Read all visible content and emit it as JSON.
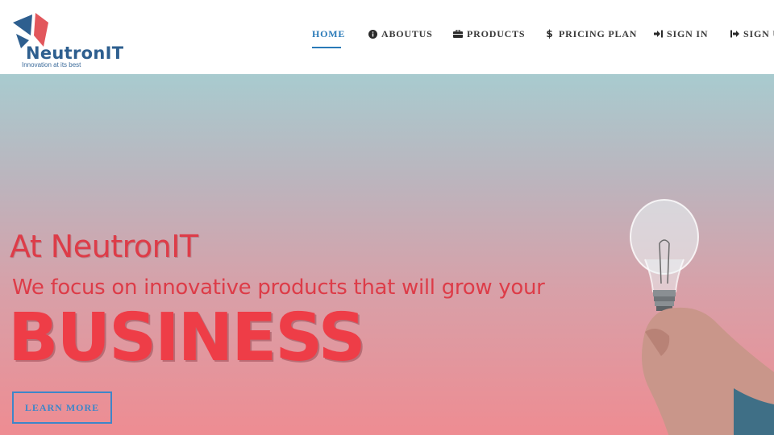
{
  "brand": {
    "name": "NeutronIT",
    "tagline": "Innovation at its best"
  },
  "nav": {
    "items": [
      {
        "label": "HOME",
        "icon": "",
        "active": true
      },
      {
        "label": "ABOUTUS",
        "icon": "info-circle-icon"
      },
      {
        "label": "PRODUCTS",
        "icon": "briefcase-icon"
      },
      {
        "label": "PRICING PLAN",
        "icon": "dollar-icon"
      },
      {
        "label": "SIGN IN",
        "icon": "sign-in-icon"
      },
      {
        "label": "SIGN U",
        "icon": "sign-up-icon"
      }
    ]
  },
  "hero": {
    "intro": "At NeutronIT",
    "subtitle": "We focus on innovative products that will grow your",
    "headline": "BUSINESS",
    "cta_label": "LEARN MORE"
  },
  "colors": {
    "accent": "#2a7ab8",
    "hero_text": "#ee3d47",
    "logo_blue": "#2e5f8f",
    "logo_red": "#e2575c"
  }
}
